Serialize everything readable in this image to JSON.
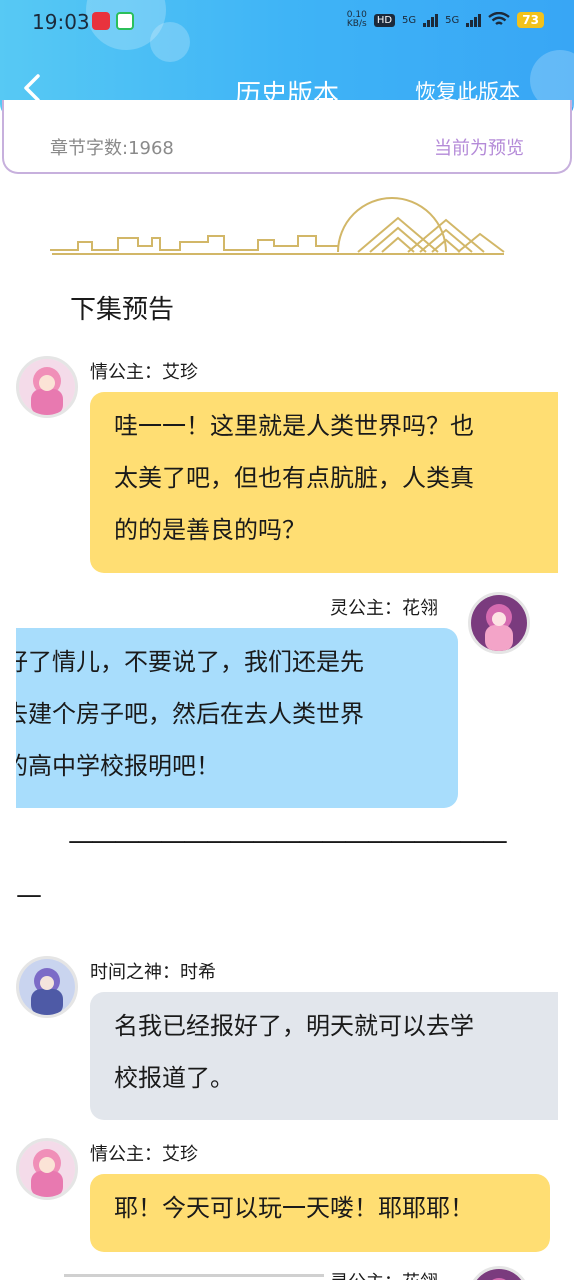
{
  "status_bar": {
    "time": "19:03",
    "net_speed_top": "0.10",
    "net_speed_unit": "KB/s",
    "hd": "HD",
    "network_1": "5G",
    "network_2": "5G",
    "battery": "73"
  },
  "header": {
    "title": "历史版本",
    "restore_label": "恢复此版本",
    "back_icon": "chevron-left-icon"
  },
  "info": {
    "word_count": "章节字数:1968",
    "preview_flag": "当前为预览"
  },
  "section_heading": "下集预告",
  "messages": [
    {
      "speaker": "情公主：艾珍",
      "side": "left",
      "lines": [
        "哇一一！这里就是人类世界吗？也",
        "太美了吧，但也有点肮脏，人类真",
        "的的是善良的吗？"
      ]
    },
    {
      "speaker": "灵公主：花翎",
      "side": "right",
      "lines": [
        "好了情儿，不要说了，我们还是先",
        "去建个房子吧，然后在去人类世界",
        "的高中学校报明吧！"
      ]
    },
    {
      "speaker": "时间之神：时希",
      "side": "left",
      "lines": [
        "名我已经报好了，明天就可以去学",
        "校报道了。"
      ]
    },
    {
      "speaker": "情公主：艾珍",
      "side": "left",
      "lines": [
        "耶！今天可以玩一天喽！耶耶耶！"
      ]
    },
    {
      "speaker": "灵公主：花翎",
      "side": "right",
      "lines": []
    }
  ],
  "divider": {
    "dashes": "———————————————————",
    "tail": "—"
  },
  "colors": {
    "header_gradient_start": "#57c9f4",
    "header_gradient_end": "#38a6f5",
    "bubble_yellow": "#ffde73",
    "bubble_blue": "#a8ddfc",
    "bubble_gray": "#e2e6ec",
    "preview_purple": "#b48ad8"
  }
}
